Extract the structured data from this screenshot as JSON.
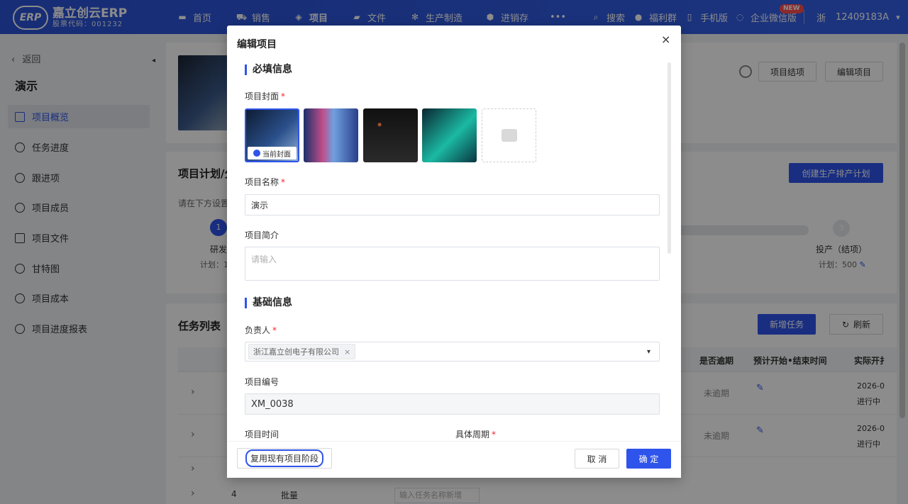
{
  "brand": {
    "name": "嘉立创云ERP",
    "sub": "股票代码：001232",
    "logo_mark": "ERP"
  },
  "nav": {
    "items": [
      {
        "label": "首页",
        "icon": "monitor-icon"
      },
      {
        "label": "销售",
        "icon": "cart-icon"
      },
      {
        "label": "项目",
        "icon": "layers-icon"
      },
      {
        "label": "文件",
        "icon": "folder-icon"
      },
      {
        "label": "生产制造",
        "icon": "gear-icon"
      },
      {
        "label": "进销存",
        "icon": "box-icon"
      },
      {
        "label": "•••",
        "icon": "more-icon"
      }
    ],
    "right": [
      {
        "label": "搜索",
        "icon": "search-icon"
      },
      {
        "label": "福利群",
        "icon": "group-icon"
      },
      {
        "label": "手机版",
        "icon": "phone-icon"
      },
      {
        "label": "企业微信版",
        "icon": "chat-icon"
      }
    ],
    "new_badge": "NEW",
    "region": "浙",
    "account": "12409183A",
    "account_caret": "▾"
  },
  "sidebar": {
    "back": "返回",
    "back_icon": "‹",
    "title": "演示",
    "collapse": "◂",
    "items": [
      {
        "label": "项目概览",
        "active": true
      },
      {
        "label": "任务进度"
      },
      {
        "label": "跟进项"
      },
      {
        "label": "项目成员"
      },
      {
        "label": "项目文件"
      },
      {
        "label": "甘特图"
      },
      {
        "label": "项目成本"
      },
      {
        "label": "项目进度报表"
      }
    ]
  },
  "main": {
    "header_buttons": {
      "finish": "项目结项",
      "edit": "编辑项目"
    },
    "plan": {
      "title": "项目计划/分",
      "hint": "请在下方设置",
      "create_btn": "创建生产排产计划",
      "step1": {
        "num": "1",
        "name": "研发",
        "plan": "计划：1"
      },
      "step3": {
        "num": "3",
        "name": "投产（结项）",
        "plan": "计划：500"
      }
    },
    "tasks": {
      "title": "任务列表",
      "add_btn": "新增任务",
      "refresh_btn": "刷新",
      "headers": [
        "是否逾期",
        "预计开始•结束时间",
        "实际开扌"
      ],
      "rows": [
        {
          "overdue": "未逾期",
          "actual_date": "2026-0",
          "actual_status": "进行中"
        },
        {
          "overdue": "未逾期",
          "actual_date": "2026-0",
          "actual_status": "进行中"
        }
      ],
      "batch_num": "4",
      "batch_label": "批量",
      "batch_placeholder": "输入任务名称新增"
    }
  },
  "modal": {
    "title": "编辑项目",
    "close": "×",
    "sec_required": "必填信息",
    "cover_label": "项目封面",
    "req_mark": "*",
    "current_cover": "当前封面",
    "name_label": "项目名称",
    "name_value": "演示",
    "desc_label": "项目简介",
    "desc_placeholder": "请输入",
    "sec_basic": "基础信息",
    "owner_label": "负责人",
    "owner_tag": "浙江嘉立创电子有限公司",
    "tag_close": "×",
    "select_caret": "▾",
    "code_label": "项目编号",
    "code_value": "XM_0038",
    "time_label": "项目时间",
    "period_label": "具体周期",
    "reuse_btn": "复用现有项目阶段",
    "cancel_btn": "取 消",
    "ok_btn": "确 定"
  },
  "colors": {
    "primary": "#2f54eb",
    "danger": "#f5222d",
    "topbar": "#2f54eb"
  }
}
